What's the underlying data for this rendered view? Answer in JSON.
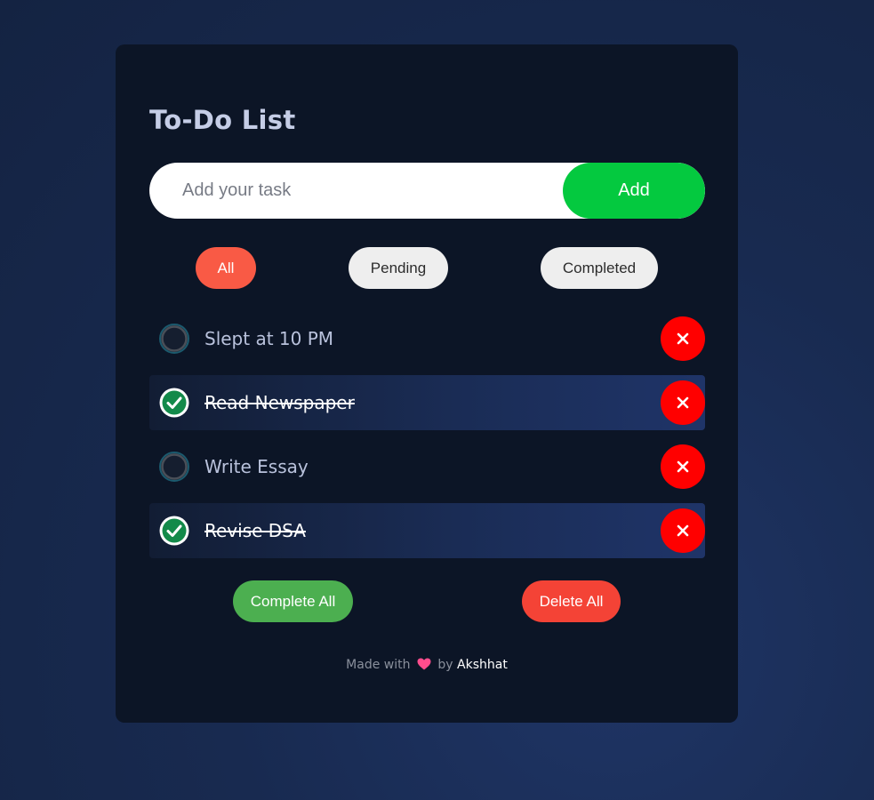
{
  "app": {
    "title": "To-Do List"
  },
  "input": {
    "placeholder": "Add your task",
    "value": "",
    "add_label": "Add"
  },
  "filters": [
    {
      "label": "All",
      "active": true
    },
    {
      "label": "Pending",
      "active": false
    },
    {
      "label": "Completed",
      "active": false
    }
  ],
  "tasks": [
    {
      "text": "Slept at 10 PM",
      "completed": false
    },
    {
      "text": "Read Newspaper",
      "completed": true
    },
    {
      "text": "Write Essay",
      "completed": false
    },
    {
      "text": "Revise DSA",
      "completed": true
    }
  ],
  "actions": {
    "complete_all_label": "Complete All",
    "delete_all_label": "Delete All"
  },
  "footer": {
    "prefix": "Made with",
    "middle": "by",
    "author": "Akshhat"
  },
  "icons": {
    "delete": "close-icon",
    "checked": "check-circle-icon",
    "unchecked": "empty-circle-icon",
    "heart": "heart-icon"
  },
  "colors": {
    "accent_add": "#04c93f",
    "filter_active": "#f95a45",
    "delete_button": "#ff0000",
    "complete_all": "#4caf50",
    "delete_all": "#f44336",
    "check_green": "#138a4a"
  }
}
